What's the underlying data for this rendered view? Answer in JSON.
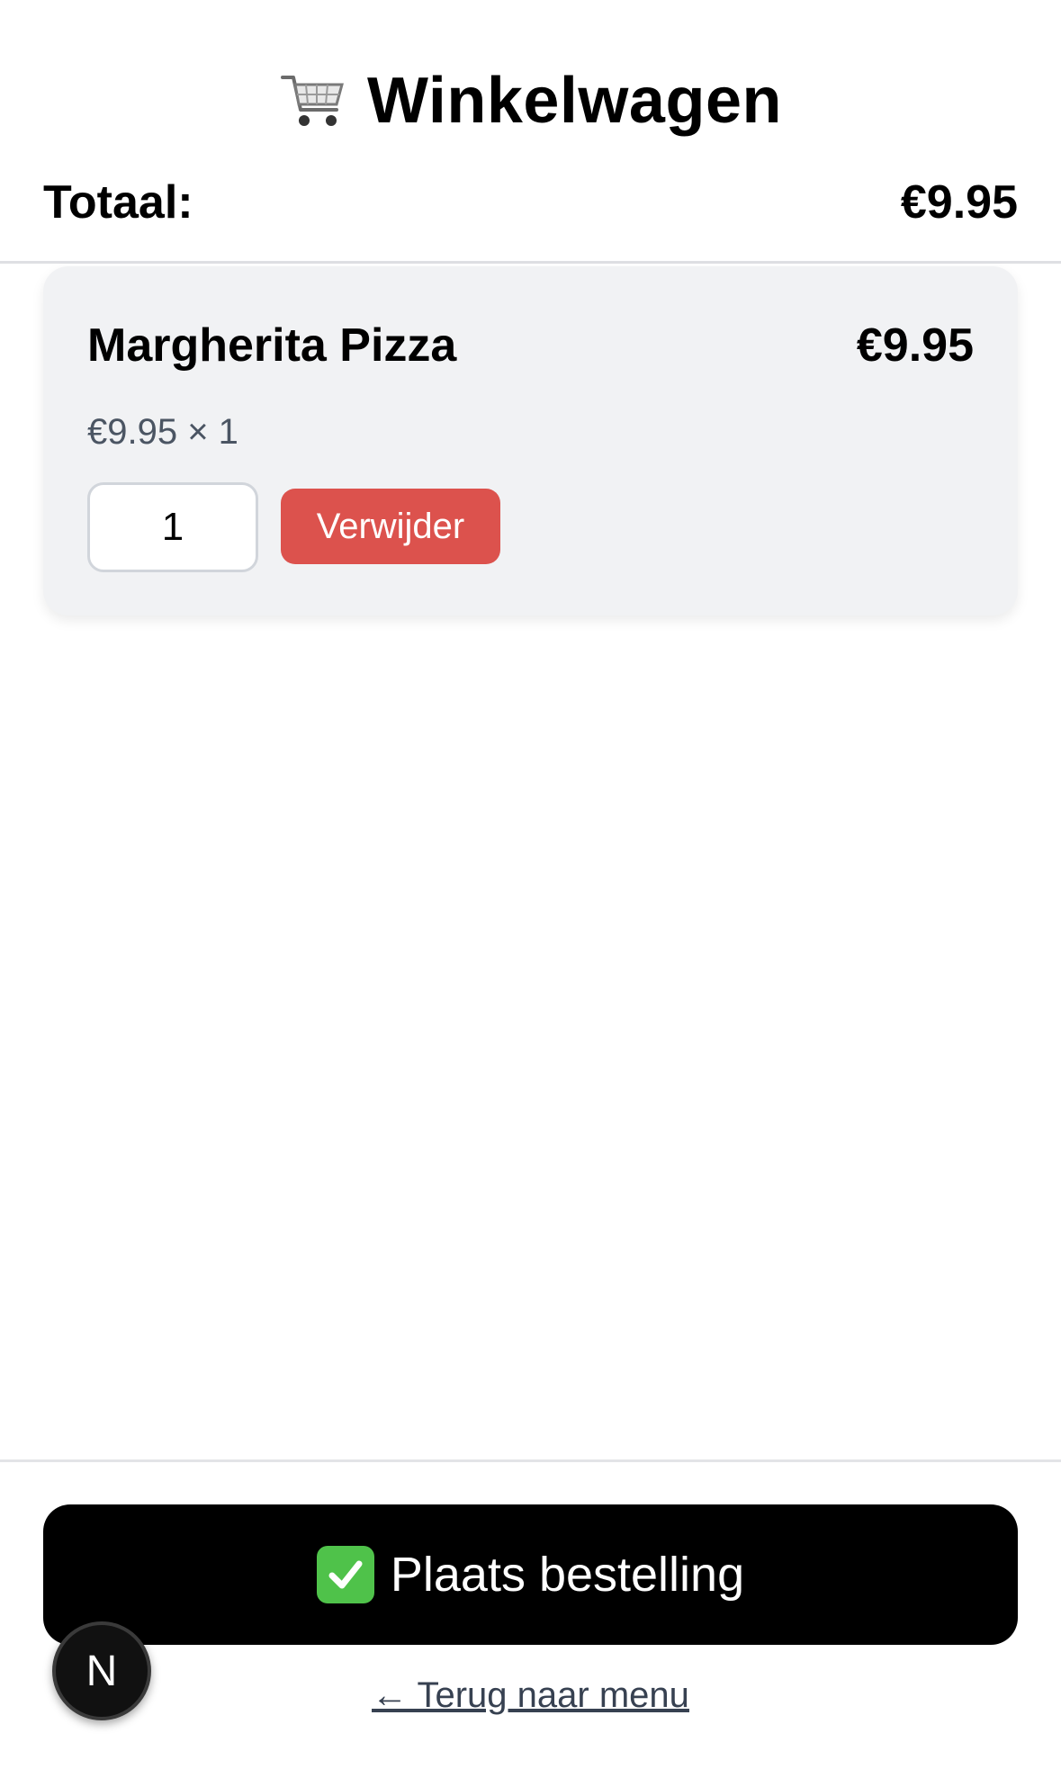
{
  "header": {
    "title": "Winkelwagen",
    "cart_icon": "shopping-cart-icon"
  },
  "summary": {
    "total_label": "Totaal:",
    "total_value": "€9.95"
  },
  "cart": {
    "items": [
      {
        "name": "Margherita Pizza",
        "price": "€9.95",
        "unit_line": "€9.95 × 1",
        "quantity": "1",
        "remove_label": "Verwijder"
      }
    ]
  },
  "footer": {
    "order_label": "Plaats bestelling",
    "order_icon": "check-mark-icon",
    "back_label": "← Terug naar menu"
  },
  "dev_badge": {
    "letter": "N"
  },
  "colors": {
    "remove_button": "#dc524d",
    "order_button": "#000000",
    "card_background": "#f1f2f4",
    "check_green": "#4fc24a"
  }
}
